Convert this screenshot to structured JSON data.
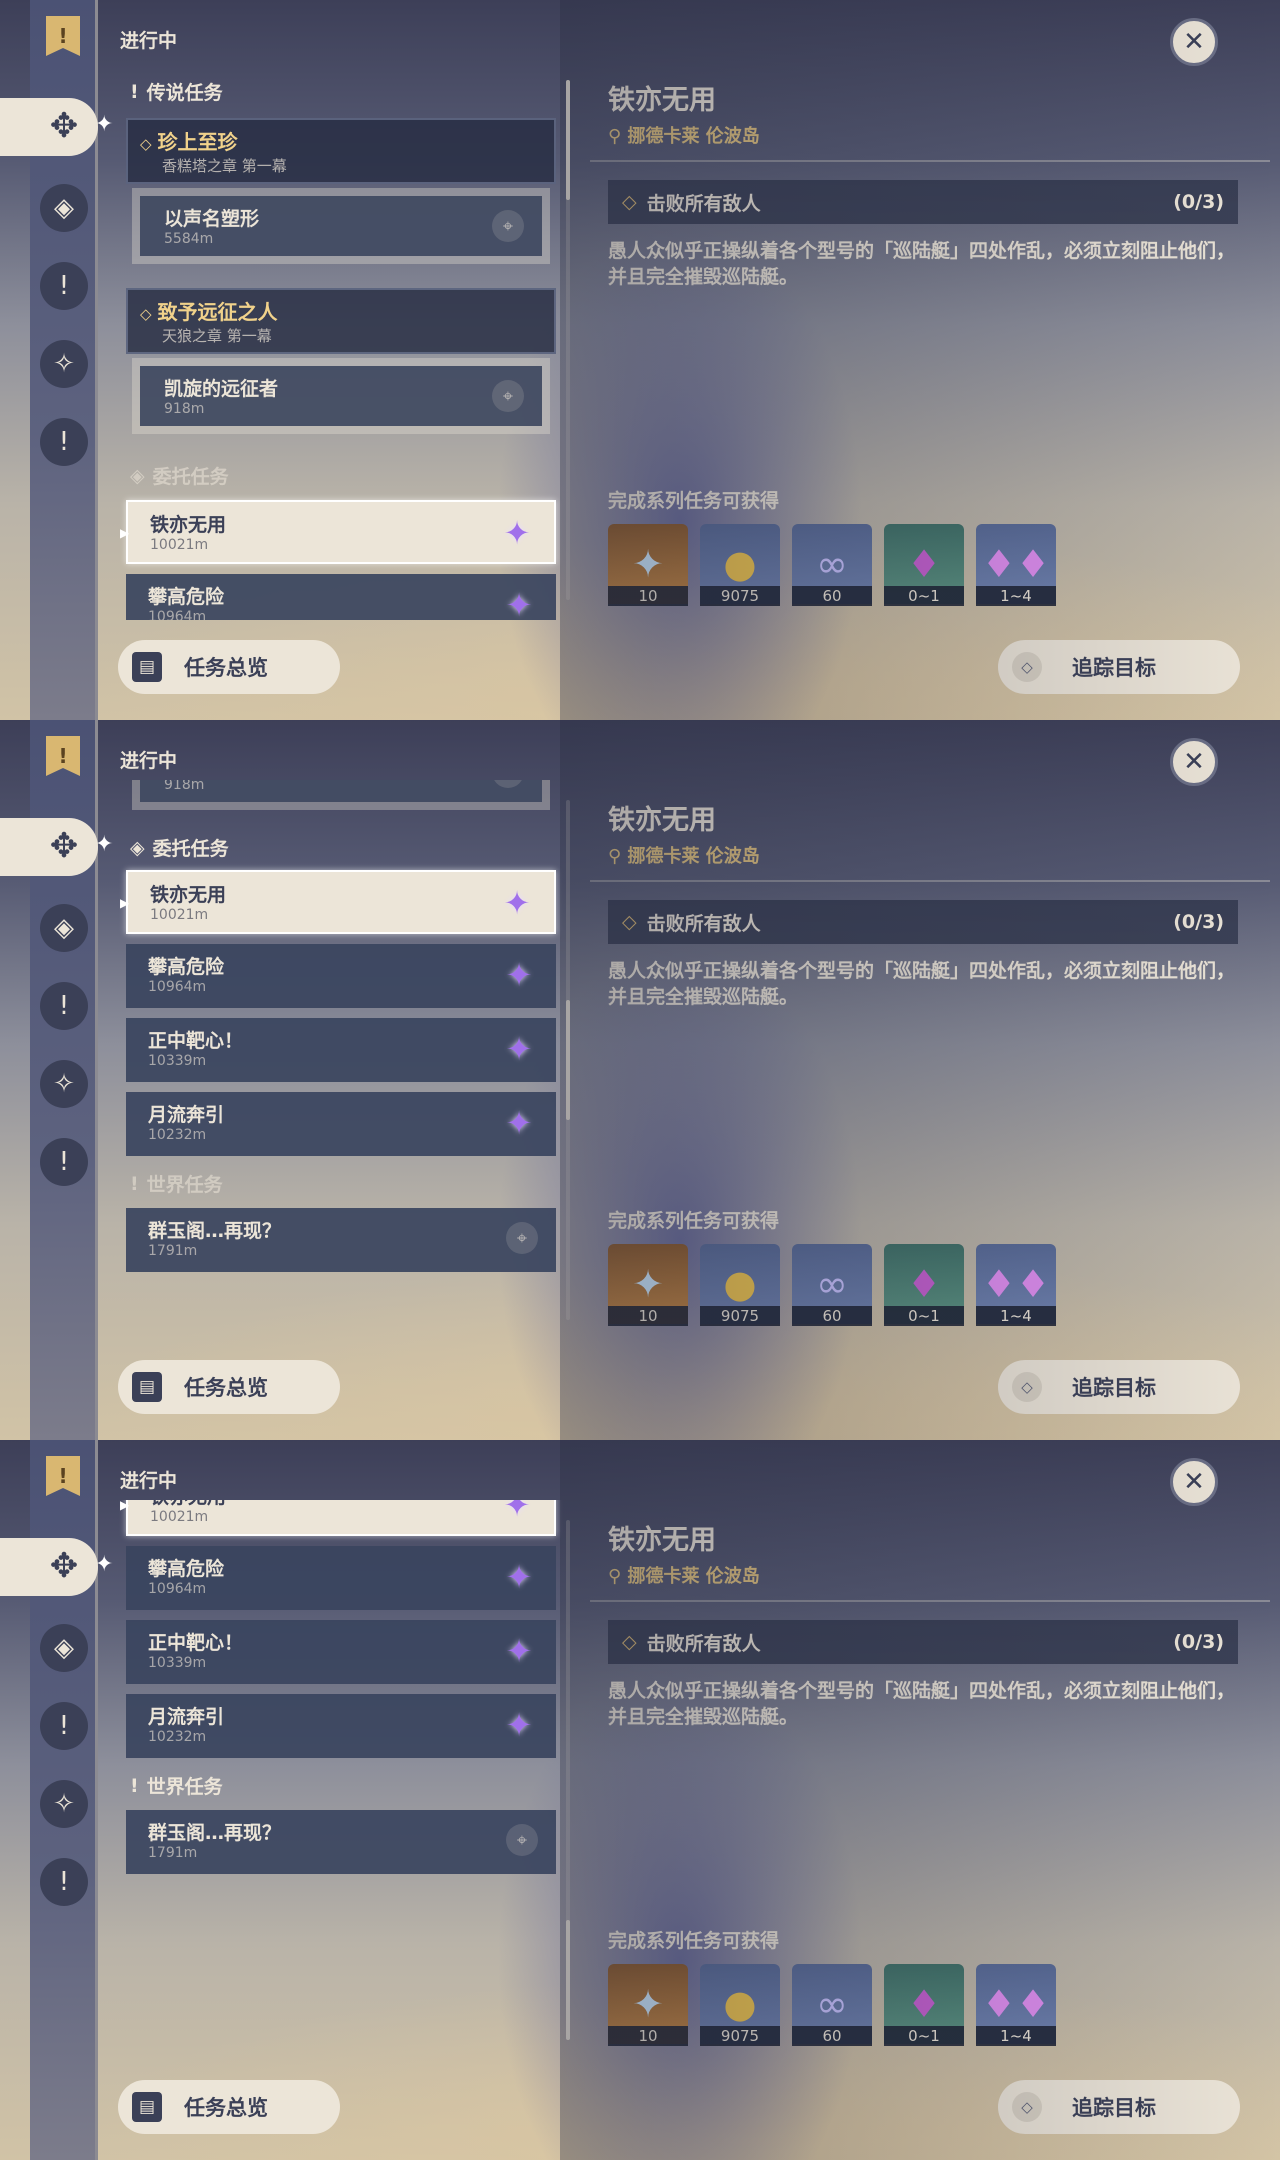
{
  "status": "进行中",
  "sections": {
    "legend": "传说任务",
    "commission": "委托任务",
    "world": "世界任务"
  },
  "legend_quests": [
    {
      "title": "珍上至珍",
      "chapter": "香糕塔之章 第一幕",
      "sub_title": "以声名塑形",
      "sub_dist": "5584m"
    },
    {
      "title": "致予远征之人",
      "chapter": "天狼之章 第一幕",
      "sub_title": "凯旋的远征者",
      "sub_dist": "918m"
    }
  ],
  "commissions": [
    {
      "title": "铁亦无用",
      "dist": "10021m"
    },
    {
      "title": "攀高危险",
      "dist": "10964m"
    },
    {
      "title": "正中靶心！",
      "dist": "10339m"
    },
    {
      "title": "月流奔引",
      "dist": "10232m"
    }
  ],
  "world_quests": [
    {
      "title": "群玉阁…再现？",
      "dist": "1791m"
    }
  ],
  "detail": {
    "title": "铁亦无用",
    "location": "挪德卡莱 伦波岛",
    "objective": "击败所有敌人",
    "progress": "(0/3)",
    "description": "愚人众似乎正操纵着各个型号的「巡陆艇」四处作乱，必须立刻阻止他们，并且完全摧毁巡陆艇。",
    "reward_label": "完成系列任务可获得",
    "rewards": [
      {
        "icon": "primogem-icon",
        "count": "10"
      },
      {
        "icon": "mora-icon",
        "count": "9075"
      },
      {
        "icon": "fellowship-icon",
        "count": "60"
      },
      {
        "icon": "crystal-icon",
        "count": "0~1"
      },
      {
        "icon": "crystal-cluster-icon",
        "count": "1~4"
      }
    ]
  },
  "buttons": {
    "overview": "任务总览",
    "track": "追踪目标"
  },
  "colors": {
    "panel_light": "#ece5d8",
    "gold": "#e1c27e",
    "dark": "#3b4057",
    "commission_star": "#a070ea"
  }
}
